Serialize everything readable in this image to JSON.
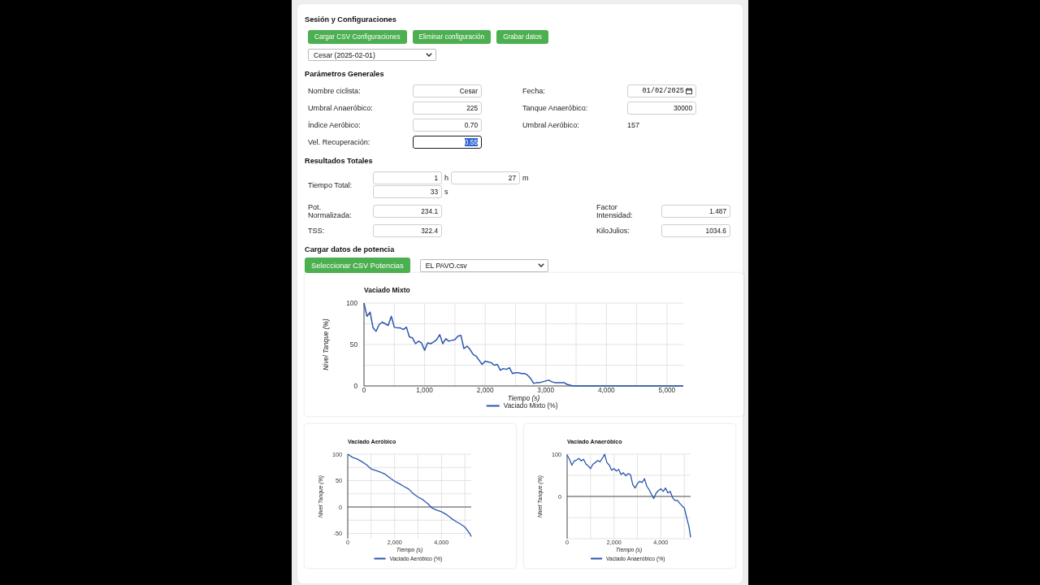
{
  "session": {
    "title": "Sesión y Configuraciones",
    "buttons": [
      "Cargar CSV Configuraciones",
      "Eliminar configuración",
      "Grabar datos"
    ],
    "config_select": {
      "value": "Cesar (2025-02-01)"
    }
  },
  "general_parameters": {
    "title": "Parámetros Generales",
    "fields": [
      {
        "kind": "text",
        "label": "Nombre ciclista:",
        "value": "Cesar",
        "focused": false,
        "text_selected": false
      },
      {
        "kind": "date",
        "label": "Fecha:",
        "value": "01/02/2025",
        "focused": false,
        "text_selected": false
      },
      {
        "kind": "text",
        "label": "Umbral Anaeróbico:",
        "value": "225",
        "focused": false,
        "text_selected": false
      },
      {
        "kind": "text",
        "label": "Tanque Anaeróbico:",
        "value": "30000",
        "focused": false,
        "text_selected": false
      },
      {
        "kind": "text",
        "label": "Índice Aeróbico:",
        "value": "0.70",
        "focused": false,
        "text_selected": false
      },
      {
        "kind": "readout",
        "label": "Umbral Aeróbico:",
        "value": "157",
        "focused": false,
        "text_selected": false
      },
      {
        "kind": "text",
        "label": "Vel. Recuperación:",
        "value": "0.55",
        "focused": true,
        "text_selected": true
      }
    ]
  },
  "results": {
    "title": "Resultados Totales",
    "total_time": {
      "label": "Tiempo Total:",
      "parts": [
        {
          "value": "1",
          "unit": "h"
        },
        {
          "value": "27",
          "unit": "m"
        },
        {
          "value": "33",
          "unit": "s"
        }
      ]
    },
    "metrics": [
      {
        "label": "Pot. Normalizada:",
        "value": "234.1"
      },
      {
        "label": "Factor Intensidad:",
        "value": "1.487"
      },
      {
        "label": "TSS:",
        "value": "322.4"
      },
      {
        "label": "KiloJulios:",
        "value": "1034.6"
      }
    ]
  },
  "power_data": {
    "title": "Cargar datos de potencia",
    "button": "Seleccionar CSV Potencias",
    "file_select": {
      "value": "EL PAVO.csv"
    }
  },
  "charts": [
    {
      "chart_data": {
        "type": "line",
        "title": "Vaciado Mixto",
        "xlabel": "Tiempo (s)",
        "ylabel": "Nivel Tanque (%)",
        "x": [
          0,
          50,
          100,
          150,
          200,
          250,
          300,
          350,
          400,
          450,
          500,
          550,
          600,
          650,
          700,
          750,
          800,
          850,
          900,
          950,
          1000,
          1050,
          1100,
          1150,
          1200,
          1250,
          1300,
          1350,
          1400,
          1450,
          1500,
          1550,
          1600,
          1650,
          1700,
          1750,
          1800,
          1850,
          1900,
          1950,
          2000,
          2050,
          2100,
          2150,
          2200,
          2250,
          2300,
          2350,
          2400,
          2450,
          2500,
          2550,
          2600,
          2650,
          2700,
          2750,
          2800,
          2850,
          2900,
          2950,
          3000,
          3050,
          3100,
          3150,
          3200,
          3250,
          3300,
          3350,
          3400,
          3450,
          3500,
          4000,
          4500,
          5000,
          5270
        ],
        "series": [
          {
            "name": "Vaciado Mixto (%)",
            "color": "#2a56b0",
            "values": [
              100,
              84,
              89,
              70,
              66,
              74,
              77,
              75,
              73,
              84,
              71,
              70,
              70,
              68,
              71,
              59,
              58,
              51,
              54,
              52,
              43,
              52,
              51,
              53,
              56,
              62,
              51,
              57,
              54,
              55,
              56,
              60,
              61,
              45,
              48,
              44,
              38,
              36,
              31,
              26,
              30,
              29,
              28,
              25,
              26,
              19,
              21,
              20,
              22,
              15,
              16,
              16,
              15,
              15,
              13,
              9,
              3,
              4,
              4,
              5,
              6,
              7,
              5,
              4,
              4,
              4,
              4,
              2,
              1,
              0,
              0,
              0,
              0,
              0,
              0
            ]
          }
        ],
        "xlim": [
          0,
          5270
        ],
        "ylim": [
          0,
          100
        ],
        "xticks": [
          {
            "value": 0,
            "label": "0"
          },
          {
            "value": 1000,
            "label": "1,000"
          },
          {
            "value": 2000,
            "label": "2,000"
          },
          {
            "value": 3000,
            "label": "3,000"
          },
          {
            "value": 4000,
            "label": "4,000"
          },
          {
            "value": 5000,
            "label": "5,000"
          }
        ],
        "yticks": [
          0,
          50,
          100
        ],
        "grid": true
      }
    },
    {
      "chart_data": {
        "type": "line",
        "title": "Vaciado Aeróbico",
        "xlabel": "Tiempo (s)",
        "ylabel": "Nivel Tanque (%)",
        "x": [
          0,
          200,
          400,
          600,
          800,
          1000,
          1200,
          1400,
          1600,
          1800,
          2000,
          2200,
          2400,
          2600,
          2800,
          3000,
          3200,
          3400,
          3600,
          3800,
          4000,
          4200,
          4400,
          4600,
          4800,
          5000,
          5200,
          5270
        ],
        "series": [
          {
            "name": "Vaciado Aeróbico (%)",
            "color": "#2a56b0",
            "values": [
              100,
              94,
              91,
              86,
              80,
              72,
              69,
              66,
              62,
              55,
              49,
              44,
              39,
              34,
              25,
              19,
              14,
              7,
              -2,
              -6,
              -9,
              -14,
              -21,
              -27,
              -32,
              -38,
              -50,
              -56
            ]
          }
        ],
        "xlim": [
          0,
          5270
        ],
        "ylim": [
          -60,
          100
        ],
        "xticks": [
          {
            "value": 0,
            "label": "0"
          },
          {
            "value": 2000,
            "label": "2,000"
          },
          {
            "value": 4000,
            "label": "4,000"
          }
        ],
        "yticks": [
          -50,
          0,
          50,
          100
        ],
        "grid": true
      }
    },
    {
      "chart_data": {
        "type": "line",
        "title": "Vaciado Anaeróbico",
        "xlabel": "Tiempo (s)",
        "ylabel": "Nivel Tanque (%)",
        "x": [
          0,
          100,
          200,
          300,
          400,
          500,
          600,
          700,
          800,
          900,
          1000,
          1100,
          1200,
          1300,
          1400,
          1500,
          1600,
          1700,
          1800,
          1900,
          2000,
          2100,
          2200,
          2300,
          2400,
          2500,
          2600,
          2700,
          2800,
          2900,
          3000,
          3100,
          3200,
          3300,
          3400,
          3500,
          3600,
          3700,
          3800,
          3900,
          4000,
          4100,
          4200,
          4300,
          4400,
          4500,
          4600,
          4700,
          4800,
          4900,
          5000,
          5100,
          5200,
          5270
        ],
        "series": [
          {
            "name": "Vaciado Anaeróbico (%)",
            "color": "#2a56b0",
            "values": [
              98,
              88,
              74,
              84,
              86,
              90,
              84,
              88,
              77,
              72,
              66,
              76,
              80,
              85,
              82,
              90,
              100,
              80,
              74,
              62,
              66,
              60,
              64,
              52,
              56,
              49,
              54,
              52,
              28,
              20,
              30,
              36,
              33,
              42,
              24,
              16,
              5,
              -5,
              8,
              14,
              18,
              12,
              20,
              8,
              12,
              -3,
              -10,
              -9,
              -16,
              -22,
              -27,
              -50,
              -72,
              -97
            ]
          }
        ],
        "xlim": [
          0,
          5270
        ],
        "ylim": [
          -100,
          100
        ],
        "xticks": [
          {
            "value": 0,
            "label": "0"
          },
          {
            "value": 2000,
            "label": "2,000"
          },
          {
            "value": 4000,
            "label": "4,000"
          }
        ],
        "yticks": [
          0,
          100
        ],
        "grid": true
      }
    }
  ]
}
